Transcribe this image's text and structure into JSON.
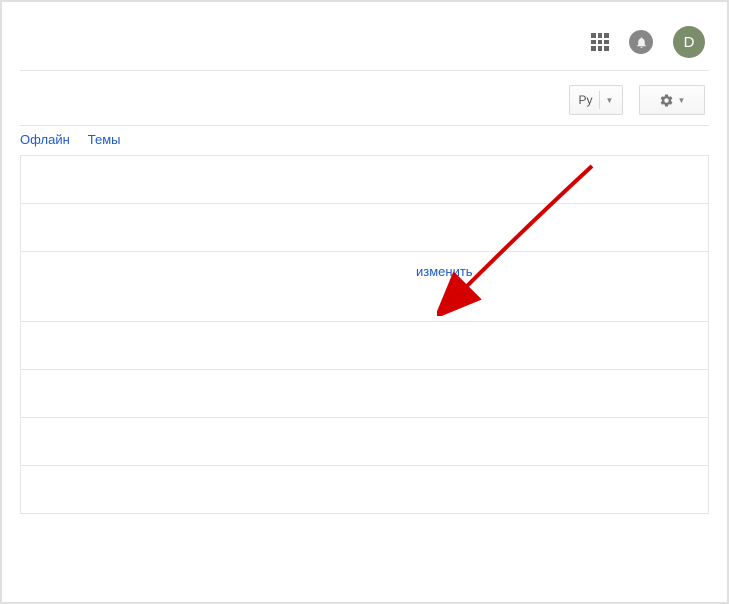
{
  "header": {
    "avatar_initial": "D"
  },
  "toolbar": {
    "lang_label": "Ру"
  },
  "tabs": {
    "offline": "Офлайн",
    "themes": "Темы"
  },
  "content": {
    "edit_link": "изменить"
  }
}
